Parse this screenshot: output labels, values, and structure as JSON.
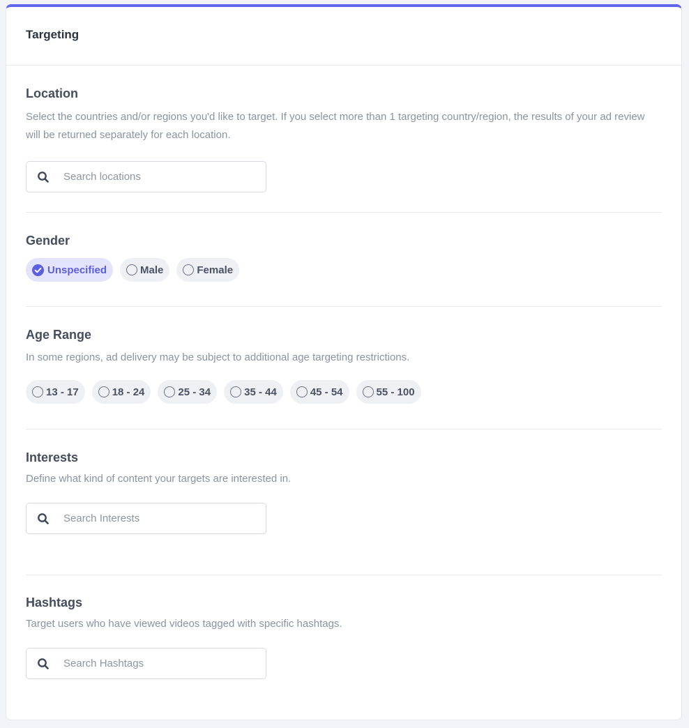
{
  "header": {
    "title": "Targeting"
  },
  "location": {
    "title": "Location",
    "description": "Select the countries and/or regions you'd like to target. If you select more than 1 targeting country/region, the results of your ad review will be returned separately for each location.",
    "search_placeholder": "Search locations",
    "search_icon": "search-icon"
  },
  "gender": {
    "title": "Gender",
    "options": [
      {
        "label": "Unspecified",
        "selected": true
      },
      {
        "label": "Male",
        "selected": false
      },
      {
        "label": "Female",
        "selected": false
      }
    ]
  },
  "age_range": {
    "title": "Age Range",
    "description": "In some regions, ad delivery may be subject to additional age targeting restrictions.",
    "options": [
      {
        "label": "13 - 17",
        "selected": false
      },
      {
        "label": "18 - 24",
        "selected": false
      },
      {
        "label": "25 - 34",
        "selected": false
      },
      {
        "label": "35 - 44",
        "selected": false
      },
      {
        "label": "45 - 54",
        "selected": false
      },
      {
        "label": "55 - 100",
        "selected": false
      }
    ]
  },
  "interests": {
    "title": "Interests",
    "description": "Define what kind of content your targets are interested in.",
    "search_placeholder": "Search Interests",
    "search_icon": "search-icon"
  },
  "hashtags": {
    "title": "Hashtags",
    "description": "Target users who have viewed videos tagged with specific hashtags.",
    "search_placeholder": "Search Hashtags",
    "search_icon": "search-icon"
  },
  "colors": {
    "accent": "#6366f1",
    "selected_bg": "#e3e4fb",
    "pill_bg": "#eef0f4",
    "text": "#3f4656",
    "muted": "#8b92a2"
  }
}
